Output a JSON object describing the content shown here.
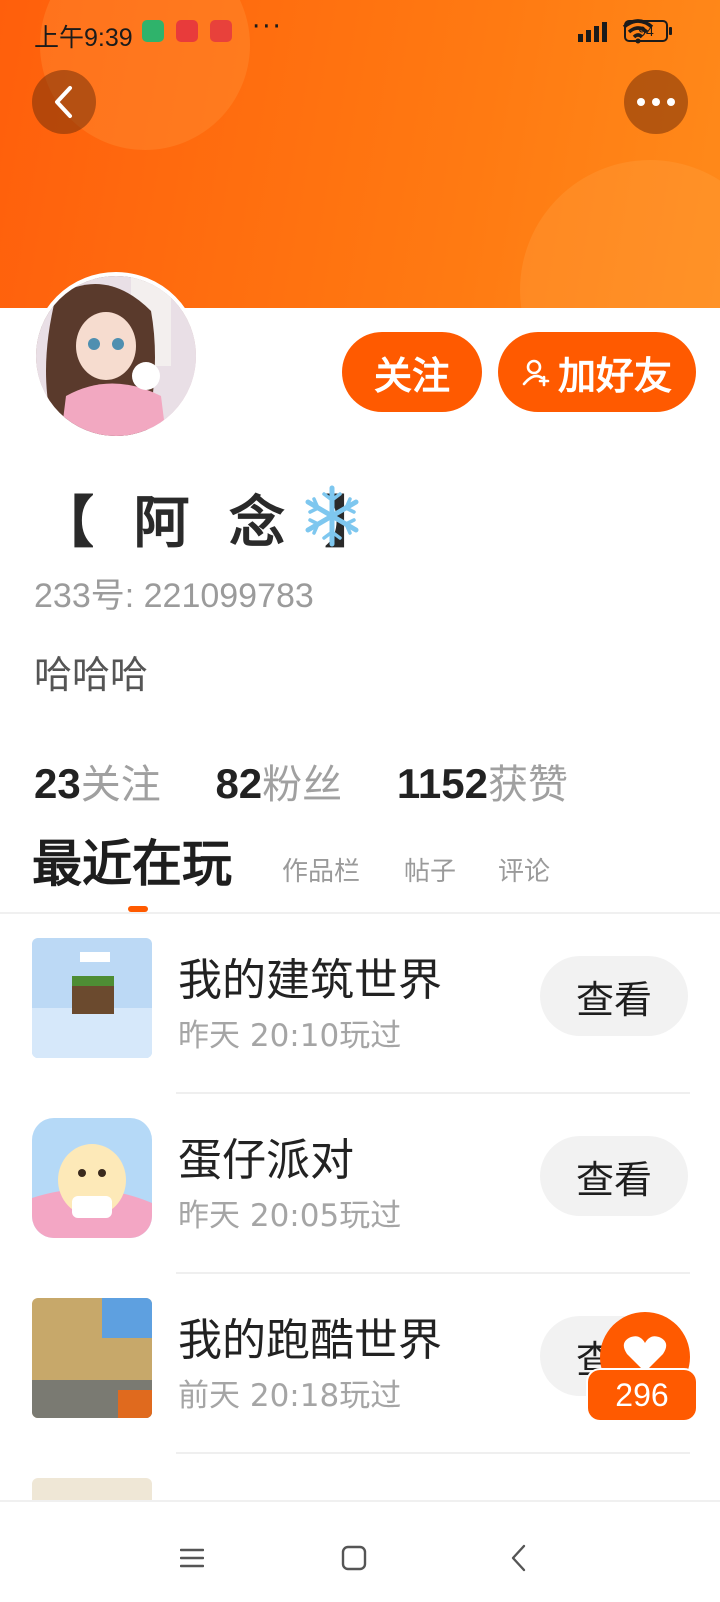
{
  "status_bar": {
    "time": "上午9:39",
    "dots": "···",
    "battery": "94"
  },
  "profile": {
    "name": "【 阿 念 】",
    "uid": "233号: 221099783",
    "bio": "哈哈哈",
    "follow_label": "关注",
    "add_friend_label": "加好友"
  },
  "stats": [
    {
      "num": "23",
      "label": "关注"
    },
    {
      "num": "82",
      "label": "粉丝"
    },
    {
      "num": "1152",
      "label": "获赞"
    }
  ],
  "tabs": [
    {
      "label": "最近在玩"
    },
    {
      "label": "作品栏"
    },
    {
      "label": "帖子"
    },
    {
      "label": "评论"
    }
  ],
  "games": [
    {
      "title": "我的建筑世界",
      "time": "昨天 20:10玩过",
      "button": "查看"
    },
    {
      "title": "蛋仔派对",
      "time": "昨天 20:05玩过",
      "button": "查看"
    },
    {
      "title": "我的跑酷世界",
      "time": "前天 20:18玩过",
      "button": "查看"
    }
  ],
  "like_count": "296",
  "colors": {
    "accent": "#ff5a00",
    "banner_start": "#ff5f0c",
    "banner_end": "#ff8a1a"
  }
}
